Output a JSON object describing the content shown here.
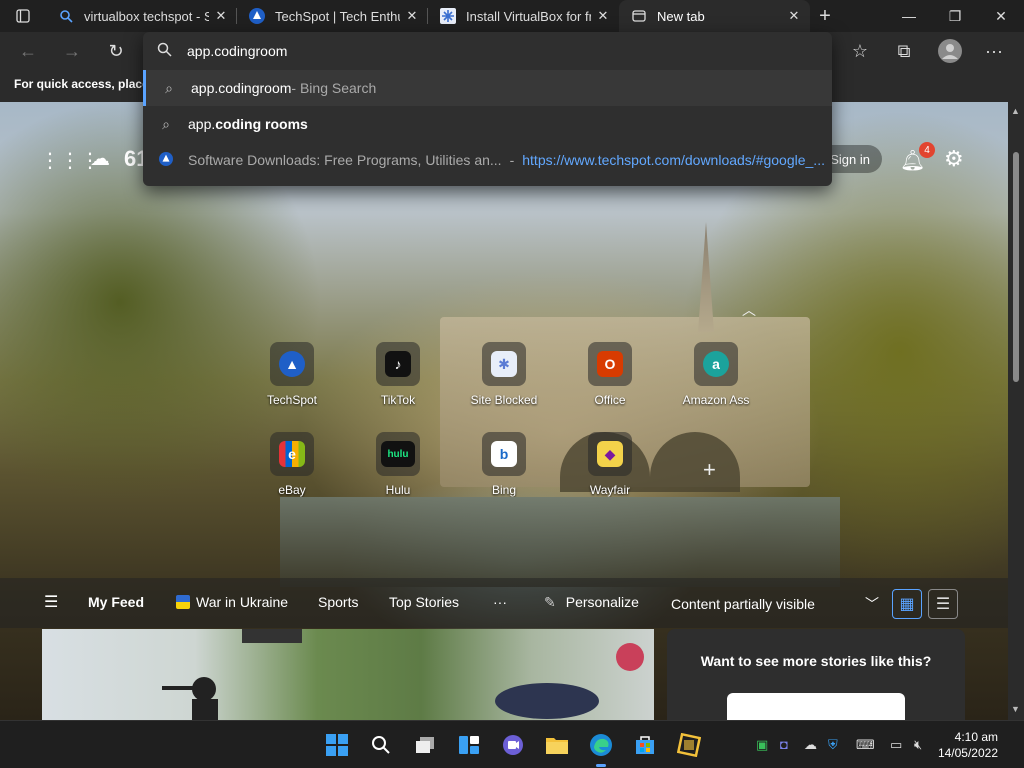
{
  "tabs": [
    {
      "title": "virtualbox techspot - Search",
      "icon": "search-icon"
    },
    {
      "title": "TechSpot | Tech Enthusiasts",
      "icon": "techspot-icon"
    },
    {
      "title": "Install VirtualBox for free",
      "icon": "snowflake-icon"
    },
    {
      "title": "New tab",
      "icon": "newtab-icon"
    }
  ],
  "omnibox": {
    "value": "app.codingroom",
    "suggestions": [
      {
        "prefix": "app.codingroom",
        "suffix": " - Bing Search"
      },
      {
        "prefix": "app.",
        "bold": "coding rooms"
      },
      {
        "title": "Software Downloads: Free Programs, Utilities an...",
        "sep": " - ",
        "url": "https://www.techspot.com/downloads/#google_..."
      }
    ]
  },
  "favbar": {
    "text": "For quick access, place y"
  },
  "widgets": {
    "temperature": "61",
    "signin": "Sign in",
    "notification_count": "4"
  },
  "tiles": [
    {
      "label": "TechSpot",
      "glyph": "▲",
      "color": "#1f5fc7"
    },
    {
      "label": "TikTok",
      "glyph": "♪",
      "color": "#111111"
    },
    {
      "label": "Site Blocked",
      "glyph": "✱",
      "color": "#5b7bd4"
    },
    {
      "label": "Office",
      "glyph": "O",
      "color": "#d83b01"
    },
    {
      "label": "Amazon Ass",
      "glyph": "a",
      "color": "#1ba39c"
    },
    {
      "label": "eBay",
      "glyph": "e",
      "color": "#e53238"
    },
    {
      "label": "Hulu",
      "glyph": "hulu",
      "color": "#1ce783"
    },
    {
      "label": "Bing",
      "glyph": "b",
      "color": "#1b6ac9"
    },
    {
      "label": "Wayfair",
      "glyph": "◆",
      "color": "#7b189f"
    }
  ],
  "feed": {
    "items": [
      "My Feed",
      "War in Ukraine",
      "Sports",
      "Top Stories",
      "···"
    ],
    "personalize": "Personalize",
    "visibility": "Content partially visible",
    "card_right_title": "Want to see more stories like this?"
  },
  "taskbar": {
    "time": "4:10 am",
    "date": "14/05/2022"
  },
  "colors": {
    "accent": "#5aa3ff",
    "badge": "#e2442f"
  }
}
